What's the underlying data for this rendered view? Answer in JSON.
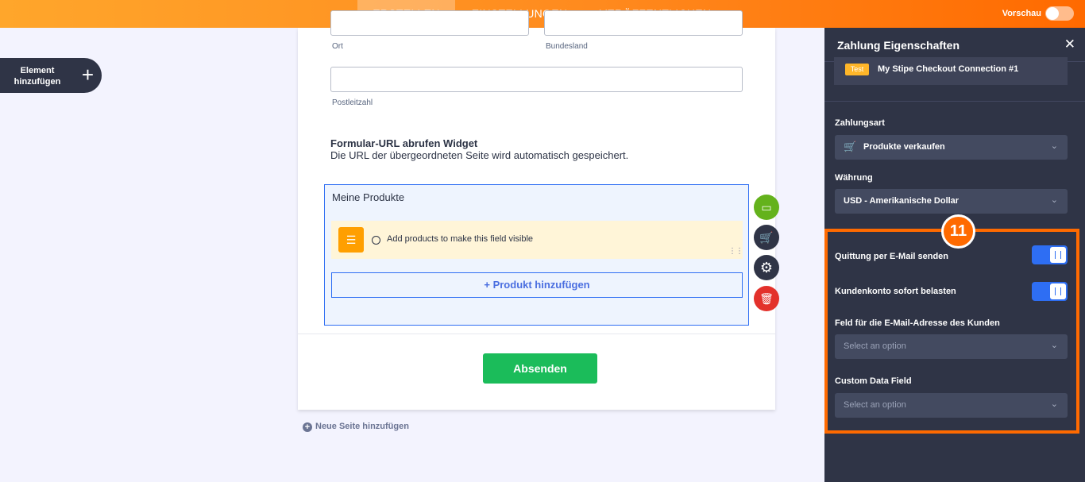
{
  "topbar": {
    "tabs": [
      {
        "label": "ERSTELLEN",
        "active": true
      },
      {
        "label": "EINSTELLUNGEN",
        "active": false
      },
      {
        "label": "VERÖFFENTLICHEN",
        "active": false
      }
    ],
    "preview_label": "Vorschau",
    "preview_on": false
  },
  "sidebar": {
    "add_element_label": "Element hinzufügen",
    "add_icon": "plus-icon"
  },
  "form": {
    "city_label": "Ort",
    "state_label": "Bundesland",
    "zip_label": "Postleitzahl",
    "widget_title": "Formular-URL abrufen Widget",
    "widget_desc": "Die URL der übergeordneten Seite wird automatisch gespeichert.",
    "products": {
      "title": "Meine Produkte",
      "notice": "Add products to make this field visible",
      "add_button": "+ Produkt hinzufügen"
    },
    "submit_label": "Absenden",
    "new_page_label": "Neue Seite hinzufügen"
  },
  "side_actions": [
    {
      "name": "payment-icon",
      "color": "#64b21c"
    },
    {
      "name": "cart-icon",
      "color": "#2f3446"
    },
    {
      "name": "gear-icon",
      "color": "#2f3446"
    },
    {
      "name": "trash-icon",
      "color": "#e3312b"
    }
  ],
  "panel": {
    "title": "Zahlung Eigenschaften",
    "connection": {
      "badge": "Test",
      "name": "My Stipe Checkout Connection #1"
    },
    "payment_type_label": "Zahlungsart",
    "payment_type_value": "Produkte verkaufen",
    "currency_label": "Währung",
    "currency_value": "USD - Amerikanische Dollar",
    "receipt_label": "Quittung per E-Mail senden",
    "receipt_on": true,
    "charge_label": "Kundenkonto sofort belasten",
    "charge_on": true,
    "email_field_label": "Feld für die E-Mail-Adresse des Kunden",
    "email_field_placeholder": "Select an option",
    "custom_field_label": "Custom Data Field",
    "custom_field_placeholder": "Select an option"
  },
  "annotation": {
    "step": "11",
    "color": "#ff6a00"
  },
  "colors": {
    "accent": "#ff6a00",
    "primary": "#2e6ef3",
    "submit": "#1bbc5a",
    "panel": "#2f3446"
  }
}
